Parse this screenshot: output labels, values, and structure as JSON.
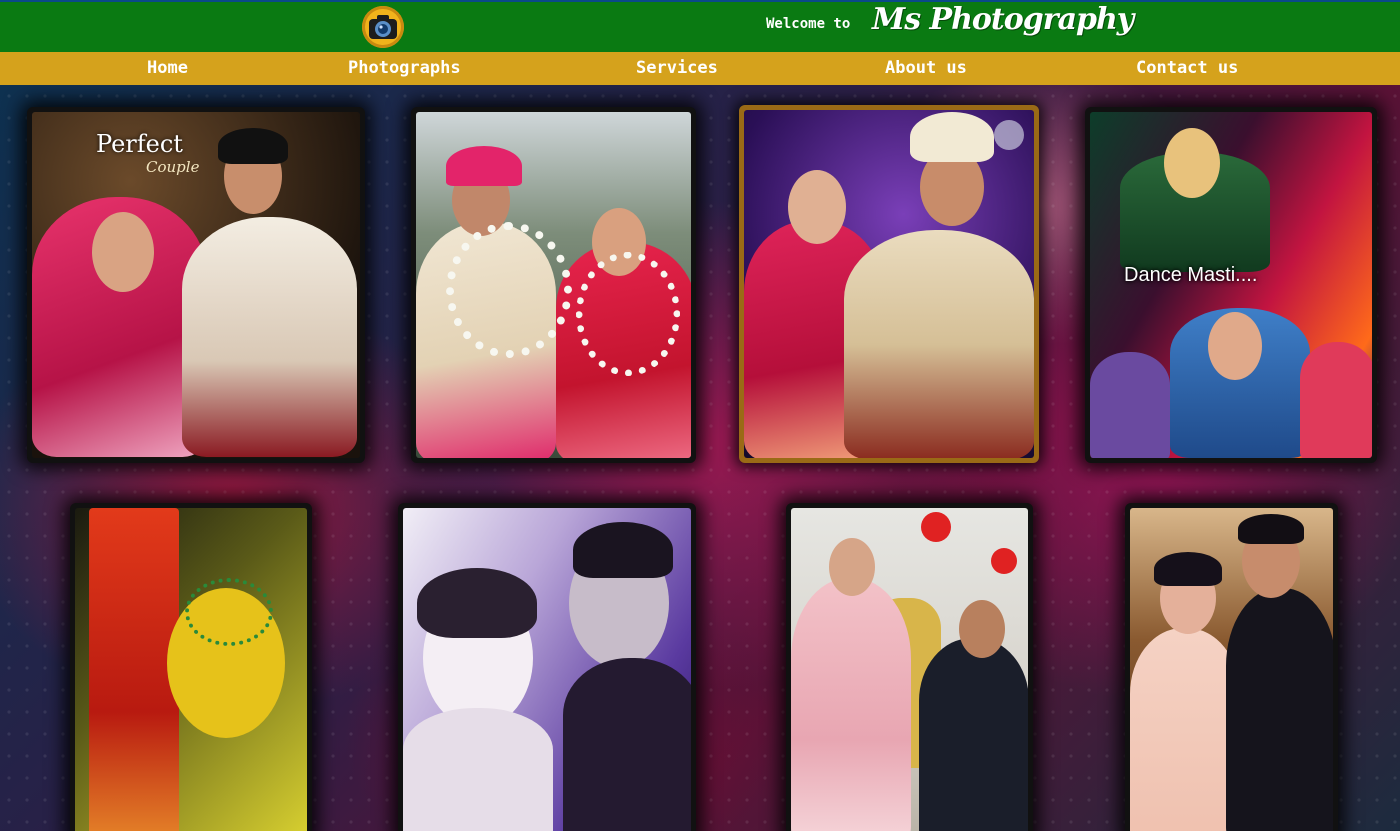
{
  "header": {
    "welcome_text": "Welcome to",
    "brand_name": "Ms Photography",
    "logo_icon": "camera-icon"
  },
  "nav": {
    "items": [
      {
        "label": "Home"
      },
      {
        "label": "Photographs"
      },
      {
        "label": "Services"
      },
      {
        "label": "About us"
      },
      {
        "label": "Contact us"
      }
    ]
  },
  "gallery": {
    "photos": [
      {
        "caption": "Perfect",
        "subcaption": "Couple"
      },
      {
        "caption": ""
      },
      {
        "caption": ""
      },
      {
        "caption": "Dance  Masti...."
      },
      {
        "caption": ""
      },
      {
        "caption": ""
      },
      {
        "caption": ""
      },
      {
        "caption": ""
      }
    ]
  },
  "colors": {
    "header_green": "#0a7a12",
    "nav_gold": "#d5a21c",
    "logo_yellow": "#f1b31b"
  }
}
